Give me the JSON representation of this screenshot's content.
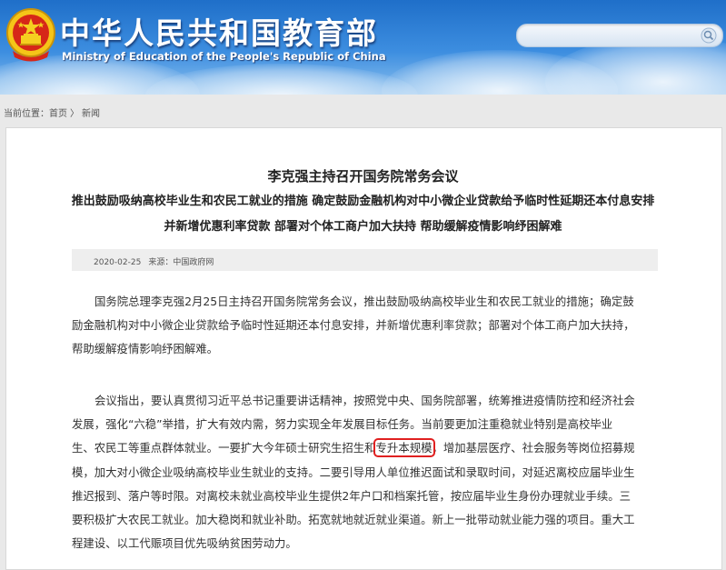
{
  "header": {
    "title": "中华人民共和国教育部",
    "subtitle": "Ministry of Education of the People's Republic of China",
    "search": {
      "placeholder": "",
      "value": ""
    },
    "icons": {
      "emblem": "national-emblem-icon",
      "search": "search-icon"
    },
    "colors": {
      "banner_top": "#1f6fc9",
      "banner_bottom": "#8cc0ee",
      "highlight": "#e02020"
    }
  },
  "breadcrumb": {
    "prefix": "当前位置：",
    "items": [
      "首页",
      "新闻"
    ],
    "separator": "〉"
  },
  "article": {
    "title": "李克强主持召开国务院常务会议",
    "subtitle_lines": [
      "推出鼓励吸纳高校毕业生和农民工就业的措施 确定鼓励金融机构对中小微企业贷款给予临时性延期还本付息安排",
      "并新增优惠利率贷款 部署对个体工商户加大扶持 帮助缓解疫情影响纾困解难"
    ],
    "date": "2020-02-25",
    "source": "来源：中国政府网",
    "paragraph1_lines": [
      "国务院总理李克强2月25日主持召开国务院常务会议，推出鼓励吸纳高校毕业生和农民工就业的措施；确定鼓",
      "励金融机构对中小微企业贷款给予临时性延期还本付息安排，并新增优惠利率贷款；部署对个体工商户加大扶持，",
      "帮助缓解疫情影响纾困解难。"
    ],
    "paragraph2_lines": [
      "会议指出，要认真贯彻习近平总书记重要讲话精神，按照党中央、国务院部署，统筹推进疫情防控和经济社会",
      "发展，强化“六稳”举措，扩大有效内需，努力实现全年发展目标任务。当前要更加注重稳就业特别是高校毕业",
      "生、农民工等重点群体就业。一要扩大今年硕士研究生招生和",
      "专升本规模",
      "，增加基层医疗、社会服务等岗位招募规",
      "模，加大对小微企业吸纳高校毕业生就业的支持。二要引导用人单位推迟面试和录取时间，对延迟离校应届毕业生",
      "推迟报到、落户等时限。对离校未就业高校毕业生提供2年户口和档案托管，按应届毕业生身份办理就业手续。三",
      "要积极扩大农民工就业。加大稳岗和就业补助。拓宽就地就近就业渠道。新上一批带动就业能力强的项目。重大工",
      "程建设、以工代赈项目优先吸纳贫困劳动力。"
    ]
  }
}
